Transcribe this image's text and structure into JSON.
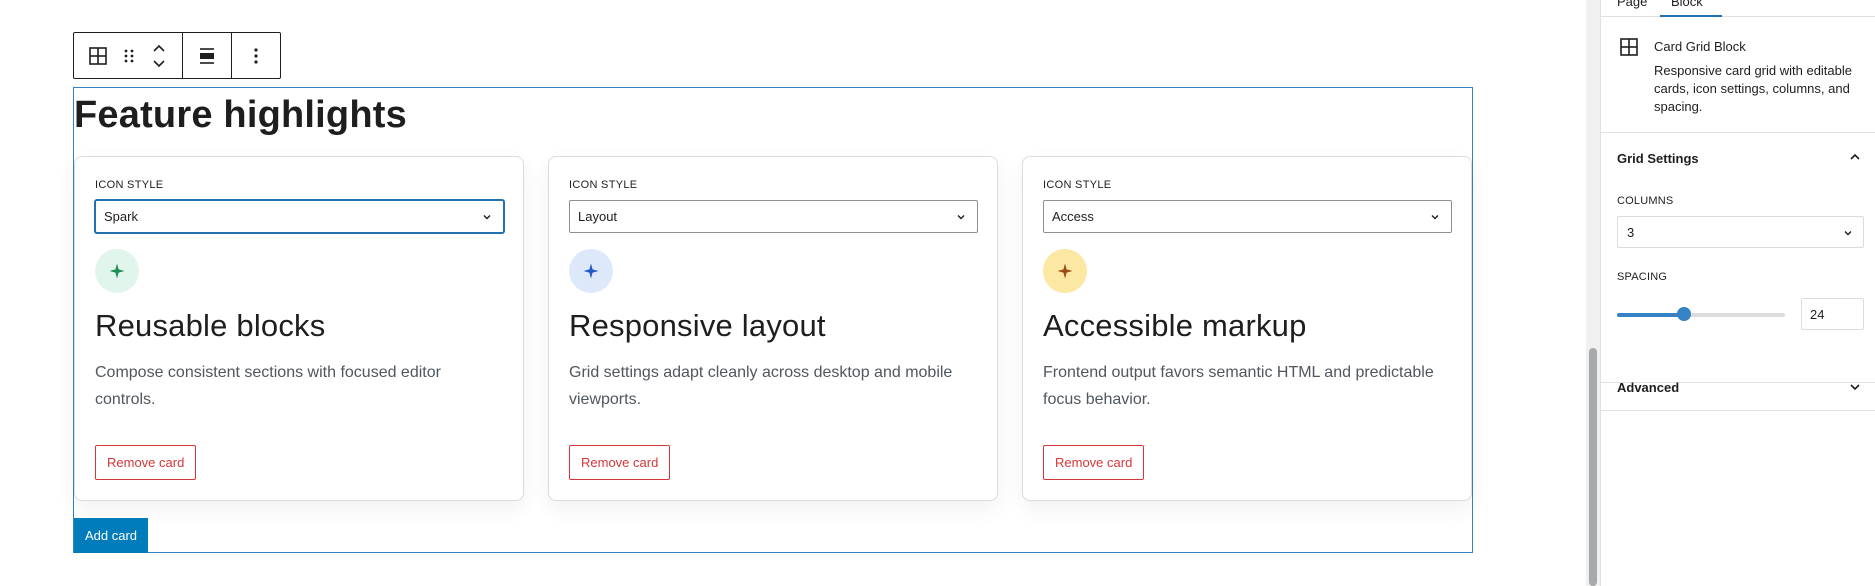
{
  "toolbar": {
    "items": [
      "block-type-icon",
      "drag-handle-icon",
      "move-up-down-icon",
      "align-icon",
      "more-options-icon"
    ]
  },
  "block": {
    "title": "Feature highlights",
    "add_card_label": "Add card",
    "cards": [
      {
        "icon_style_label": "ICON STYLE",
        "icon_style_value": "Spark",
        "icon": "sparkle-icon",
        "icon_bg": "#e1f5ec",
        "icon_color": "#1e8e56",
        "heading": "Reusable blocks",
        "text": "Compose consistent sections with focused editor controls.",
        "remove_label": "Remove card"
      },
      {
        "icon_style_label": "ICON STYLE",
        "icon_style_value": "Layout",
        "icon": "sparkle-icon",
        "icon_bg": "#dde9fb",
        "icon_color": "#2459c7",
        "heading": "Responsive layout",
        "text": "Grid settings adapt cleanly across desktop and mobile viewports.",
        "remove_label": "Remove card"
      },
      {
        "icon_style_label": "ICON STYLE",
        "icon_style_value": "Access",
        "icon": "sparkle-icon",
        "icon_bg": "#fce7a3",
        "icon_color": "#9a4c12",
        "heading": "Accessible markup",
        "text": "Frontend output favors semantic HTML and predictable focus behavior.",
        "remove_label": "Remove card"
      }
    ]
  },
  "sidebar": {
    "tabs": [
      "Page",
      "Block"
    ],
    "block_card": {
      "icon": "grid-icon",
      "name": "Card Grid Block",
      "description": "Responsive card grid with editable cards, icon settings, columns, and spacing."
    },
    "grid_settings": {
      "title": "Grid Settings",
      "columns_label": "COLUMNS",
      "columns_value": "3",
      "spacing_label": "SPACING",
      "spacing_value": "24",
      "spacing_fraction": 0.4
    },
    "advanced": {
      "title": "Advanced"
    }
  },
  "colors": {
    "accent": "#007cba",
    "focus": "#2271b1",
    "danger": "#d63638"
  }
}
